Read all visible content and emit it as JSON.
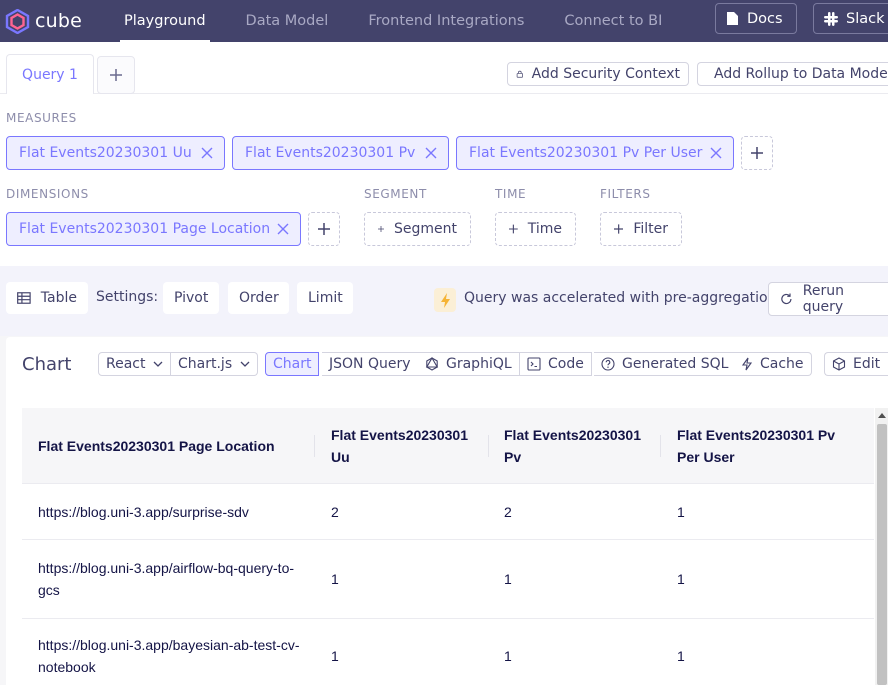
{
  "app": {
    "logo_text": "cube",
    "nav": [
      {
        "label": "Playground",
        "active": true
      },
      {
        "label": "Data Model",
        "active": false
      },
      {
        "label": "Frontend Integrations",
        "active": false
      },
      {
        "label": "Connect to BI",
        "active": false
      }
    ],
    "docs_label": "Docs",
    "slack_label": "Slack"
  },
  "query_tabs": {
    "tabs": [
      {
        "label": "Query 1",
        "active": true
      }
    ],
    "add_security_context": "Add Security Context",
    "add_rollup": "Add Rollup to Data Model"
  },
  "builder": {
    "measures_label": "MEASURES",
    "measures": [
      "Flat Events20230301 Uu",
      "Flat Events20230301 Pv",
      "Flat Events20230301 Pv Per User"
    ],
    "dimensions_label": "DIMENSIONS",
    "dimensions": [
      "Flat Events20230301 Page Location"
    ],
    "segment_label": "SEGMENT",
    "segment_button": "Segment",
    "time_label": "TIME",
    "time_button": "Time",
    "filters_label": "FILTERS",
    "filter_button": "Filter"
  },
  "toolbar": {
    "table_label": "Table",
    "settings_label": "Settings:",
    "pivot_label": "Pivot",
    "order_label": "Order",
    "limit_label": "Limit",
    "accelerated_text": "Query was accelerated with pre-aggregation",
    "rerun_label": "Rerun query"
  },
  "chart_card": {
    "title": "Chart",
    "framework": "React",
    "library": "Chart.js",
    "tabs": [
      "Chart",
      "JSON Query",
      "GraphiQL",
      "Code",
      "Generated SQL",
      "Cache"
    ],
    "selected_tab": "Chart",
    "edit_label": "Edit"
  },
  "table": {
    "columns": [
      "Flat Events20230301 Page Location",
      "Flat Events20230301 Uu",
      "Flat Events20230301 Pv",
      "Flat Events20230301 Pv Per User"
    ],
    "rows": [
      [
        "https://blog.uni-3.app/surprise-sdv",
        "2",
        "2",
        "1"
      ],
      [
        "https://blog.uni-3.app/airflow-bq-query-to-gcs",
        "1",
        "1",
        "1"
      ],
      [
        "https://blog.uni-3.app/bayesian-ab-test-cv-notebook",
        "1",
        "1",
        "1"
      ]
    ]
  },
  "colors": {
    "nav_bg": "#43436b",
    "accent": "#7a77ff",
    "pill_bg": "#eeeeff",
    "toolbar_bg": "#f3f3fb",
    "bolt": "#f5b335"
  }
}
